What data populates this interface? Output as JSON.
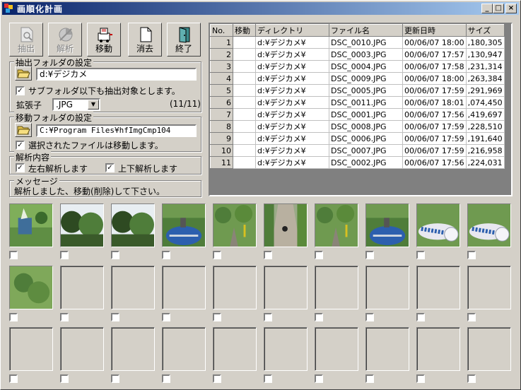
{
  "window": {
    "title": "画順化計画",
    "minimize": "_",
    "maximize": "□",
    "close": "×"
  },
  "toolbar": [
    {
      "id": "extract",
      "label": "抽出",
      "enabled": false
    },
    {
      "id": "analyze",
      "label": "解析",
      "enabled": false
    },
    {
      "id": "move",
      "label": "移動",
      "enabled": true
    },
    {
      "id": "delete",
      "label": "消去",
      "enabled": true
    },
    {
      "id": "exit",
      "label": "終了",
      "enabled": true
    }
  ],
  "extract_group": {
    "legend": "抽出フォルダの設定",
    "folder": "d:¥デジカメ",
    "subfolder_label": "サブフォルダ以下も抽出対象とします。",
    "subfolder_checked": true,
    "ext_label": "拡張子",
    "ext_value": ".JPG",
    "count": "(11/11)"
  },
  "move_group": {
    "legend": "移動フォルダの設定",
    "folder": "C:¥Program Files¥hfImgCmp104",
    "move_label": "選択されたファイルは移動します。",
    "move_checked": true
  },
  "analysis_group": {
    "legend": "解析内容",
    "lr_label": "左右解析します",
    "lr_checked": true,
    "ud_label": "上下解析します",
    "ud_checked": true
  },
  "message_group": {
    "legend": "メッセージ",
    "text": "解析しました、移動(削除)して下さい。"
  },
  "table": {
    "headers": [
      "No.",
      "移動",
      "ディレクトリ",
      "ファイル名",
      "更新日時",
      "サイズ"
    ],
    "rows": [
      [
        "1",
        "",
        "d:¥デジカメ¥",
        "DSC_0010.JPG",
        "00/06/07 18:00",
        ",180,305"
      ],
      [
        "2",
        "",
        "d:¥デジカメ¥",
        "DSC_0003.JPG",
        "00/06/07 17:57",
        ",130,947"
      ],
      [
        "3",
        "",
        "d:¥デジカメ¥",
        "DSC_0004.JPG",
        "00/06/07 17:58",
        ",231,314"
      ],
      [
        "4",
        "",
        "d:¥デジカメ¥",
        "DSC_0009.JPG",
        "00/06/07 18:00",
        ",263,384"
      ],
      [
        "5",
        "",
        "d:¥デジカメ¥",
        "DSC_0005.JPG",
        "00/06/07 17:59",
        ",291,969"
      ],
      [
        "6",
        "",
        "d:¥デジカメ¥",
        "DSC_0011.JPG",
        "00/06/07 18:01",
        ",074,450"
      ],
      [
        "7",
        "",
        "d:¥デジカメ¥",
        "DSC_0001.JPG",
        "00/06/07 17:56",
        ",419,697"
      ],
      [
        "8",
        "",
        "d:¥デジカメ¥",
        "DSC_0008.JPG",
        "00/06/07 17:59",
        ",228,510"
      ],
      [
        "9",
        "",
        "d:¥デジカメ¥",
        "DSC_0006.JPG",
        "00/06/07 17:59",
        ",191,640"
      ],
      [
        "10",
        "",
        "d:¥デジカメ¥",
        "DSC_0007.JPG",
        "00/06/07 17:59",
        ",216,958"
      ],
      [
        "11",
        "",
        "d:¥デジカメ¥",
        "DSC_0002.JPG",
        "00/06/07 17:56",
        ",224,031"
      ]
    ]
  },
  "thumbnails": [
    {
      "scene": "plant"
    },
    {
      "scene": "trees"
    },
    {
      "scene": "trees"
    },
    {
      "scene": "machine"
    },
    {
      "scene": "garden"
    },
    {
      "scene": "path"
    },
    {
      "scene": "garden"
    },
    {
      "scene": "machine"
    },
    {
      "scene": "pipes"
    },
    {
      "scene": "pipes"
    },
    {
      "scene": "green"
    }
  ],
  "colors": {
    "title_start": "#0a246a",
    "title_end": "#a6caf0",
    "face": "#d4d0c8",
    "foliage": "#4f7d3a",
    "sky": "#e8eef2",
    "ground": "#8a8478",
    "blue": "#2c5fae"
  }
}
